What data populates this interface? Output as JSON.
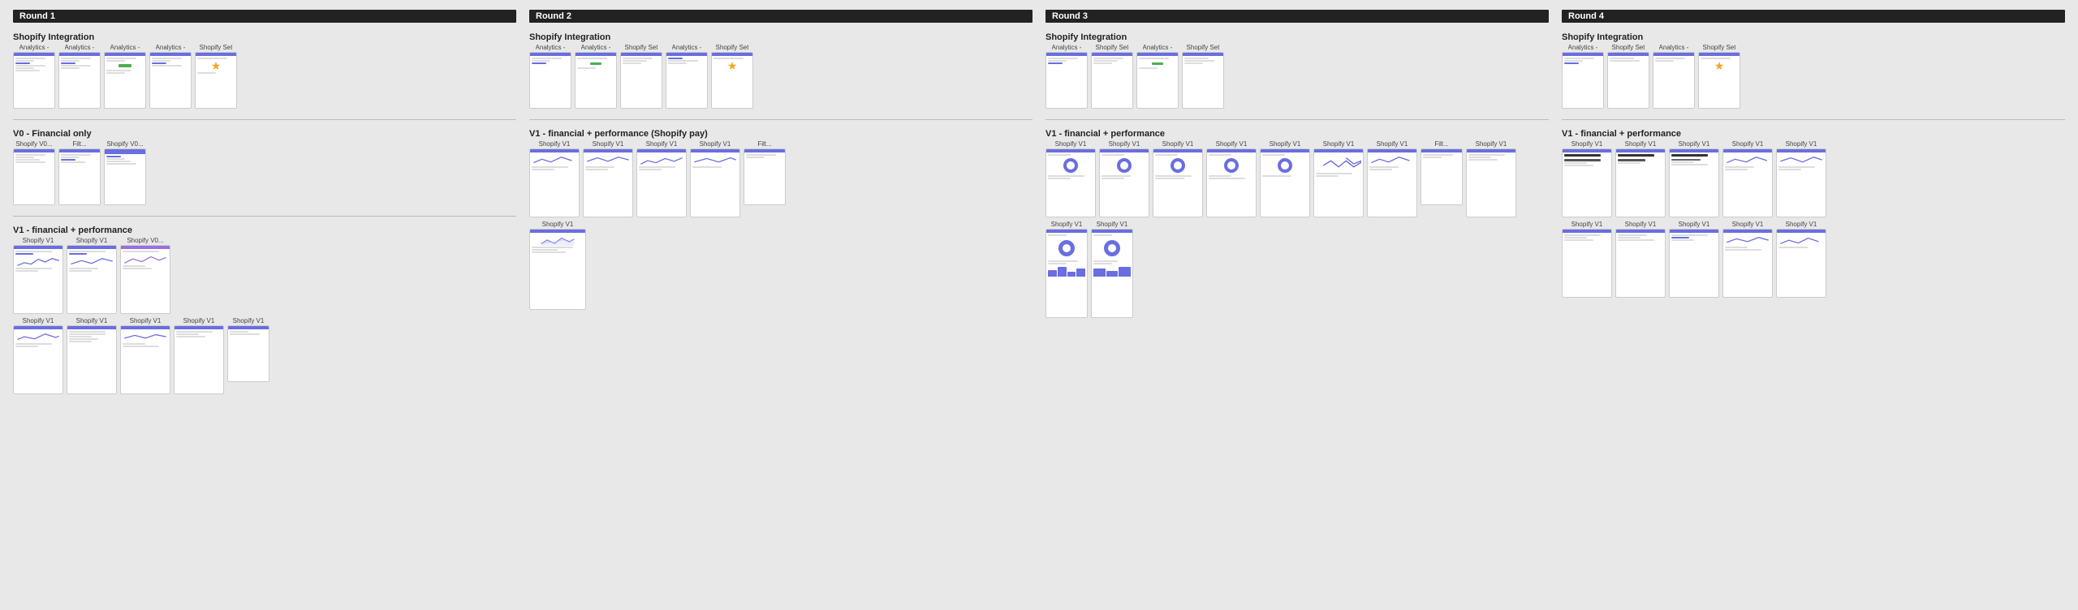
{
  "rounds": [
    {
      "label": "Round 1",
      "groups": [
        {
          "title": "Shopify Integration",
          "screens": [
            {
              "label": "Analytics -",
              "type": "lines",
              "size": "sm"
            },
            {
              "label": "Analytics -",
              "type": "lines",
              "size": "sm"
            },
            {
              "label": "Analytics -",
              "type": "lines-green",
              "size": "sm"
            },
            {
              "label": "Analytics -",
              "type": "lines",
              "size": "sm"
            },
            {
              "label": "Shopify Set",
              "type": "icon-star",
              "size": "sm"
            }
          ]
        },
        {
          "title": "V0 - Financial only",
          "screens": [
            {
              "label": "Shopify V0...",
              "type": "lines",
              "size": "sm"
            },
            {
              "label": "Filt...",
              "type": "lines",
              "size": "sm"
            },
            {
              "label": "Shopify V0...",
              "type": "lines-accent",
              "size": "sm"
            }
          ]
        },
        {
          "title": "V1 - financial + performance",
          "screens": [
            {
              "label": "Shopify V1",
              "type": "wave-blue",
              "size": "md"
            },
            {
              "label": "Shopify V1",
              "type": "wave-blue2",
              "size": "md"
            },
            {
              "label": "Shopify V0...",
              "type": "wave-purple",
              "size": "md"
            }
          ],
          "screens2": [
            {
              "label": "Shopify V1",
              "type": "wave-blue",
              "size": "md"
            },
            {
              "label": "Shopify V1",
              "type": "lines-table",
              "size": "md"
            },
            {
              "label": "Shopify V1",
              "type": "wave-blue",
              "size": "md"
            },
            {
              "label": "Shopify V1",
              "type": "lines",
              "size": "md"
            },
            {
              "label": "Shopify V1",
              "type": "lines",
              "size": "sm"
            }
          ]
        }
      ]
    },
    {
      "label": "Round 2",
      "groups": [
        {
          "title": "Shopify Integration",
          "screens": [
            {
              "label": "Analytics -",
              "type": "lines",
              "size": "sm"
            },
            {
              "label": "Analytics -",
              "type": "lines-green",
              "size": "sm"
            },
            {
              "label": "Shopify Set",
              "type": "lines",
              "size": "sm"
            },
            {
              "label": "Analytics -",
              "type": "lines",
              "size": "sm"
            },
            {
              "label": "Shopify Set",
              "type": "icon-star",
              "size": "sm"
            }
          ]
        },
        {
          "title": "V1 - financial + performance (Shopify pay)",
          "screens": [
            {
              "label": "Shopify V1",
              "type": "wave-blue",
              "size": "md"
            },
            {
              "label": "Shopify V1",
              "type": "wave-blue",
              "size": "md"
            },
            {
              "label": "Shopify V1",
              "type": "wave-blue",
              "size": "md"
            },
            {
              "label": "Shopify V1",
              "type": "wave-blue",
              "size": "md"
            },
            {
              "label": "Filt...",
              "type": "lines",
              "size": "sm"
            }
          ],
          "screens2": [
            {
              "label": "Shopify V1",
              "type": "wave-big",
              "size": "lg"
            }
          ]
        }
      ]
    },
    {
      "label": "Round 3",
      "groups": [
        {
          "title": "Shopify Integration",
          "screens": [
            {
              "label": "Analytics -",
              "type": "lines",
              "size": "sm"
            },
            {
              "label": "Shopify Set",
              "type": "lines",
              "size": "sm"
            },
            {
              "label": "Analytics -",
              "type": "lines-green",
              "size": "sm"
            },
            {
              "label": "Shopify Set",
              "type": "lines",
              "size": "sm"
            }
          ]
        },
        {
          "title": "V1 - financial + performance",
          "screens": [
            {
              "label": "Shopify V1",
              "type": "circle",
              "size": "md"
            },
            {
              "label": "Shopify V1",
              "type": "circle",
              "size": "md"
            },
            {
              "label": "Shopify V1",
              "type": "circle",
              "size": "md"
            },
            {
              "label": "Shopify V1",
              "type": "circle",
              "size": "md"
            },
            {
              "label": "Shopify V1",
              "type": "circle",
              "size": "md"
            },
            {
              "label": "Shopify V1",
              "type": "wave-right",
              "size": "md"
            },
            {
              "label": "Shopify V1",
              "type": "wave-blue",
              "size": "md"
            },
            {
              "label": "Filt...",
              "type": "lines",
              "size": "sm"
            },
            {
              "label": "Shopify V1",
              "type": "lines",
              "size": "md"
            }
          ],
          "screens2": [
            {
              "label": "Shopify V1",
              "type": "circle-tall",
              "size": "tall"
            },
            {
              "label": "Shopify V1",
              "type": "circle-tall",
              "size": "tall"
            }
          ]
        }
      ]
    },
    {
      "label": "Round 4",
      "groups": [
        {
          "title": "Shopify Integration",
          "screens": [
            {
              "label": "Analytics -",
              "type": "lines",
              "size": "sm"
            },
            {
              "label": "Shopify Set",
              "type": "lines",
              "size": "sm"
            },
            {
              "label": "Analytics -",
              "type": "lines",
              "size": "sm"
            },
            {
              "label": "Shopify Set",
              "type": "icon-star",
              "size": "sm"
            }
          ]
        },
        {
          "title": "V1 - financial + performance",
          "screens": [
            {
              "label": "Shopify V1",
              "type": "lines-bold",
              "size": "md"
            },
            {
              "label": "Shopify V1",
              "type": "lines-bold",
              "size": "md"
            },
            {
              "label": "Shopify V1",
              "type": "lines-bold",
              "size": "md"
            },
            {
              "label": "Shopify V1",
              "type": "wave-blue",
              "size": "md"
            },
            {
              "label": "Shopify V1",
              "type": "wave-blue",
              "size": "md"
            }
          ],
          "screens2": [
            {
              "label": "Shopify V1",
              "type": "lines",
              "size": "md"
            },
            {
              "label": "Shopify V1",
              "type": "lines",
              "size": "md"
            },
            {
              "label": "Shopify V1",
              "type": "lines",
              "size": "md"
            },
            {
              "label": "Shopify V1",
              "type": "wave-blue",
              "size": "md"
            },
            {
              "label": "Shopify V1",
              "type": "wave-blue",
              "size": "md"
            }
          ]
        }
      ]
    }
  ]
}
